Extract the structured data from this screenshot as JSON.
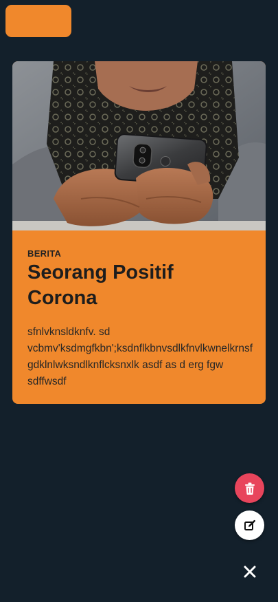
{
  "top_button": {
    "color": "#f0882c"
  },
  "card": {
    "image_description_icon": "photo-person-holding-phone",
    "category": "BERITA",
    "title": "Seorang Positif Corona",
    "body": "sfnlvknsldknfv. sd vcbmv'ksdmgfkbn';ksdnflkbnvsdlkfnvlkwnelkrnsfgdklnlwksndlknflcksnxlk asdf as d erg fgw sdffwsdf",
    "background_color": "#f0882c"
  },
  "actions": {
    "delete_icon": "trash-icon",
    "delete_color": "#e8455c",
    "edit_icon": "edit-icon",
    "edit_color": "#ffffff",
    "close_icon": "close-icon"
  },
  "theme": {
    "background": "#13202b"
  }
}
